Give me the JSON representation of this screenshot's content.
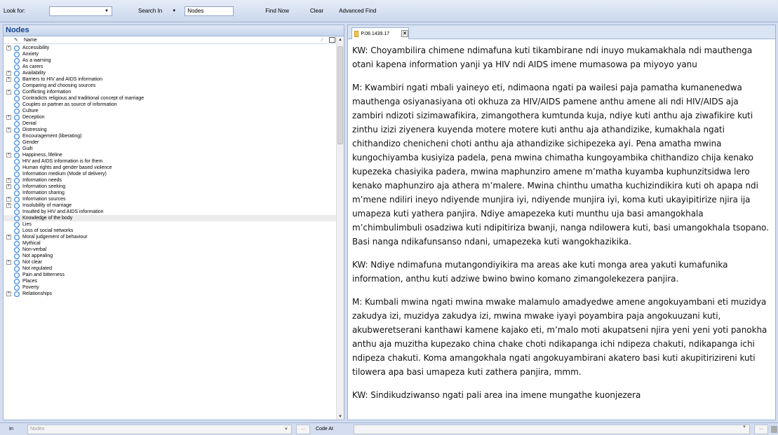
{
  "find_bar": {
    "look_for_label": "Look for:",
    "look_for_value": "",
    "search_in_label": "Search In",
    "search_in_value": "Nodes",
    "find_now": "Find Now",
    "clear": "Clear",
    "advanced_find": "Advanced Find"
  },
  "nodes_panel": {
    "title": "Nodes",
    "column_name": "Name",
    "items": [
      {
        "label": "Accessibility",
        "expandable": true
      },
      {
        "label": "Anxiety",
        "expandable": false
      },
      {
        "label": "As a warning",
        "expandable": false
      },
      {
        "label": "As carers",
        "expandable": false
      },
      {
        "label": "Availability",
        "expandable": true
      },
      {
        "label": "Barriers to HIV and AIDS information",
        "expandable": true
      },
      {
        "label": "Comparing and choosing sources",
        "expandable": false
      },
      {
        "label": "Conflicting information",
        "expandable": true
      },
      {
        "label": "Contradicts religious and traditional concept of marriage",
        "expandable": false
      },
      {
        "label": "Couples or partner as source of information",
        "expandable": false
      },
      {
        "label": "Culture",
        "expandable": false
      },
      {
        "label": "Deception",
        "expandable": true
      },
      {
        "label": "Denial",
        "expandable": false
      },
      {
        "label": "Distressing",
        "expandable": true
      },
      {
        "label": "Encouragement (liberating)",
        "expandable": false
      },
      {
        "label": "Gender",
        "expandable": false
      },
      {
        "label": "Guilt",
        "expandable": false
      },
      {
        "label": "Happiness, lifeline",
        "expandable": true
      },
      {
        "label": "HIV and AIDS information is for them",
        "expandable": false
      },
      {
        "label": "Human rights and gender based violence",
        "expandable": false
      },
      {
        "label": "Information medium (Mode of delivery)",
        "expandable": false
      },
      {
        "label": "Information needs",
        "expandable": true
      },
      {
        "label": "Information seeking",
        "expandable": true
      },
      {
        "label": "Information sharing",
        "expandable": false
      },
      {
        "label": "Information sources",
        "expandable": true
      },
      {
        "label": "Insolubility of marriage",
        "expandable": true
      },
      {
        "label": "Insulted by HIV and AIDS information",
        "expandable": false
      },
      {
        "label": "Knowledge of the body",
        "expandable": false,
        "selected": true
      },
      {
        "label": "Lies",
        "expandable": false
      },
      {
        "label": "Loss of social networks",
        "expandable": false
      },
      {
        "label": "Moral judgement of behaviour",
        "expandable": true
      },
      {
        "label": "Mythical",
        "expandable": false
      },
      {
        "label": "Non-verbal",
        "expandable": false
      },
      {
        "label": "Not appealing",
        "expandable": false
      },
      {
        "label": "Not clear",
        "expandable": true
      },
      {
        "label": "Not regulated",
        "expandable": false
      },
      {
        "label": "Pain and bitterness",
        "expandable": false
      },
      {
        "label": "Places",
        "expandable": false
      },
      {
        "label": "Poverty",
        "expandable": false
      },
      {
        "label": "Relationships",
        "expandable": true
      }
    ]
  },
  "document": {
    "tab_label": "P.08.1439.17",
    "paragraphs": [
      "KW: Choyambilira chimene ndimafuna kuti tikambirane ndi inuyo mukamakhala ndi mauthenga otani kapena information yanji ya HIV ndi AIDS imene mumasowa pa miyoyo yanu",
      "M: Kwambiri ngati mbali yaineyo eti, ndimaona ngati pa wailesi paja pamatha kumanenedwa mauthenga osiyanasiyana oti okhuza za HIV/AIDS pamene anthu amene ali ndi HIV/AIDS aja zambiri ndizoti sizimawafikira, zimangothera kumtunda kuja, ndiye kuti anthu aja ziwafikire kuti zinthu izizi ziyenera kuyenda motere motere kuti anthu aja athandizike, kumakhala ngati chithandizo chenicheni choti anthu aja athandizike sichipezeka ayi. Pena amatha mwina kungochiyamba kusiyiza padela, pena mwina chimatha kungoyambika chithandizo chija kenako kupezeka chasiyika padera, mwina maphunziro amene m’matha kuyamba kuphunzitsidwa lero kenako maphunziro aja athera m’malere. Mwina chinthu umatha kuchizindikira kuti oh apapa ndi m’mene ndiliri ineyo ndiyende munjira iyi, ndiyende munjira iyi, koma kuti ukayipitirize njira ija umapeza kuti yathera panjira. Ndiye amapezeka kuti munthu uja basi amangokhala m’chimbulimbuli osadziwa kuti ndipitiriza bwanji, nanga ndilowera kuti, basi umangokhala tsopano. Basi nanga ndikafunsanso ndani, umapezeka kuti wangokhazikika.",
      "KW: Ndiye ndimafuna mutangondiyikira ma areas ake kuti monga area yakuti kumafunika information, anthu kuti adziwe bwino bwino komano zimangolekezera panjira.",
      "M: Kumbali mwina ngati mwina mwake malamulo amadyedwe amene angokuyambani eti muzidya zakudya izi, muzidya zakudya izi, mwina mwake iyayi poyambira paja angokuuzani kuti, akubweretserani kanthawi kamene kajako eti, m’malo moti akupatseni njira yeni yeni yoti panokha anthu aja muzitha kupezako china chake choti ndikapanga ichi ndipeza chakuti, ndikapanga ichi ndipeza chakuti. Koma amangokhala ngati angokuyambirani akatero basi kuti akupitirizireni kuti tilowera apa basi umapeza kuti zathera panjira, mmm.",
      "KW: Sindikudziwanso ngati pali area ina imene mungathe kuonjezera"
    ]
  },
  "bottom_bar": {
    "in_label": "In",
    "in_value": "Nodes",
    "dots": "...",
    "code_at_label": "Code At",
    "code_at_value": ""
  }
}
